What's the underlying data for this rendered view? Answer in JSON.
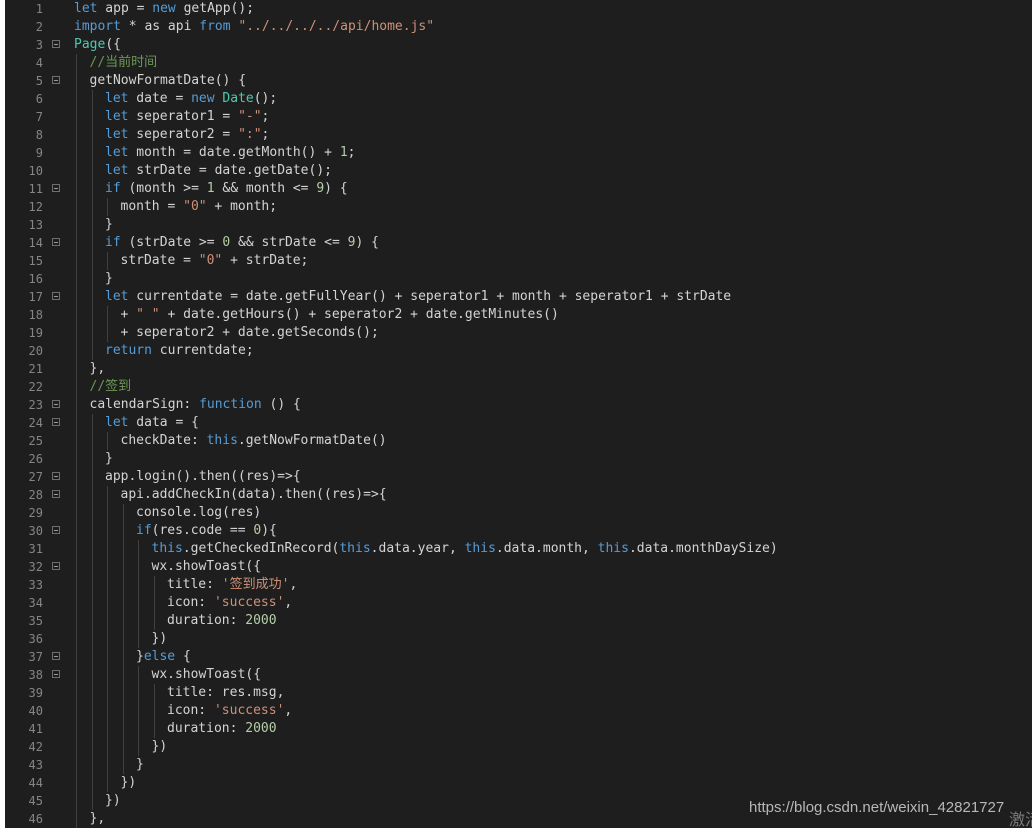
{
  "theme": {
    "default": "#d4d4d4",
    "keyword": "#569cd6",
    "string": "#ce9178",
    "number": "#b5cea8",
    "comment": "#6a9955",
    "class": "#4ec9b0"
  },
  "fold_lines": [
    3,
    5,
    11,
    14,
    17,
    23,
    24,
    27,
    28,
    30,
    32,
    37,
    38
  ],
  "lines": [
    {
      "n": "1",
      "indent": 0,
      "tokens": [
        [
          "kw",
          "let"
        ],
        [
          "p",
          " app = "
        ],
        [
          "kw",
          "new"
        ],
        [
          "p",
          " getApp();"
        ]
      ]
    },
    {
      "n": "2",
      "indent": 0,
      "tokens": [
        [
          "kw",
          "import"
        ],
        [
          "p",
          " * as api "
        ],
        [
          "kw",
          "from"
        ],
        [
          "p",
          " "
        ],
        [
          "str",
          "\"../../../../api/home.js\""
        ]
      ]
    },
    {
      "n": "3",
      "indent": 0,
      "tokens": [
        [
          "cls",
          "Page"
        ],
        [
          "p",
          "({"
        ]
      ]
    },
    {
      "n": "4",
      "indent": 1,
      "tokens": [
        [
          "cm",
          "//当前时间"
        ]
      ]
    },
    {
      "n": "5",
      "indent": 1,
      "tokens": [
        [
          "p",
          "getNowFormatDate() {"
        ]
      ]
    },
    {
      "n": "6",
      "indent": 2,
      "tokens": [
        [
          "kw",
          "let"
        ],
        [
          "p",
          " date = "
        ],
        [
          "kw",
          "new"
        ],
        [
          "p",
          " "
        ],
        [
          "cls",
          "Date"
        ],
        [
          "p",
          "();"
        ]
      ]
    },
    {
      "n": "7",
      "indent": 2,
      "tokens": [
        [
          "kw",
          "let"
        ],
        [
          "p",
          " seperator1 = "
        ],
        [
          "str",
          "\"-\""
        ],
        [
          "p",
          ";"
        ]
      ]
    },
    {
      "n": "8",
      "indent": 2,
      "tokens": [
        [
          "kw",
          "let"
        ],
        [
          "p",
          " seperator2 = "
        ],
        [
          "str",
          "\":\""
        ],
        [
          "p",
          ";"
        ]
      ]
    },
    {
      "n": "9",
      "indent": 2,
      "tokens": [
        [
          "kw",
          "let"
        ],
        [
          "p",
          " month = date.getMonth() + "
        ],
        [
          "num",
          "1"
        ],
        [
          "p",
          ";"
        ]
      ]
    },
    {
      "n": "10",
      "indent": 2,
      "tokens": [
        [
          "kw",
          "let"
        ],
        [
          "p",
          " strDate = date.getDate();"
        ]
      ]
    },
    {
      "n": "11",
      "indent": 2,
      "tokens": [
        [
          "kw",
          "if"
        ],
        [
          "p",
          " (month >= "
        ],
        [
          "num",
          "1"
        ],
        [
          "p",
          " && month <= "
        ],
        [
          "num",
          "9"
        ],
        [
          "p",
          ") {"
        ]
      ]
    },
    {
      "n": "12",
      "indent": 3,
      "tokens": [
        [
          "p",
          "month = "
        ],
        [
          "str",
          "\"0\""
        ],
        [
          "p",
          " + month;"
        ]
      ]
    },
    {
      "n": "13",
      "indent": 2,
      "tokens": [
        [
          "p",
          "}"
        ]
      ]
    },
    {
      "n": "14",
      "indent": 2,
      "tokens": [
        [
          "kw",
          "if"
        ],
        [
          "p",
          " (strDate >= "
        ],
        [
          "num",
          "0"
        ],
        [
          "p",
          " && strDate <= "
        ],
        [
          "num",
          "9"
        ],
        [
          "p",
          ") {"
        ]
      ]
    },
    {
      "n": "15",
      "indent": 3,
      "tokens": [
        [
          "p",
          "strDate = "
        ],
        [
          "str",
          "\"0\""
        ],
        [
          "p",
          " + strDate;"
        ]
      ]
    },
    {
      "n": "16",
      "indent": 2,
      "tokens": [
        [
          "p",
          "}"
        ]
      ]
    },
    {
      "n": "17",
      "indent": 2,
      "tokens": [
        [
          "kw",
          "let"
        ],
        [
          "p",
          " currentdate = date.getFullYear() + seperator1 + month + seperator1 + strDate"
        ]
      ]
    },
    {
      "n": "18",
      "indent": 3,
      "tokens": [
        [
          "p",
          "+ "
        ],
        [
          "str",
          "\" \""
        ],
        [
          "p",
          " + date.getHours() + seperator2 + date.getMinutes()"
        ]
      ]
    },
    {
      "n": "19",
      "indent": 3,
      "tokens": [
        [
          "p",
          "+ seperator2 + date.getSeconds();"
        ]
      ]
    },
    {
      "n": "20",
      "indent": 2,
      "tokens": [
        [
          "kw",
          "return"
        ],
        [
          "p",
          " currentdate;"
        ]
      ]
    },
    {
      "n": "21",
      "indent": 1,
      "tokens": [
        [
          "p",
          "},"
        ]
      ]
    },
    {
      "n": "22",
      "indent": 1,
      "tokens": [
        [
          "cm",
          "//签到"
        ]
      ]
    },
    {
      "n": "23",
      "indent": 1,
      "tokens": [
        [
          "p",
          "calendarSign: "
        ],
        [
          "kw",
          "function"
        ],
        [
          "p",
          " () {"
        ]
      ]
    },
    {
      "n": "24",
      "indent": 2,
      "tokens": [
        [
          "kw",
          "let"
        ],
        [
          "p",
          " data = {"
        ]
      ]
    },
    {
      "n": "25",
      "indent": 3,
      "tokens": [
        [
          "p",
          "checkDate: "
        ],
        [
          "kw",
          "this"
        ],
        [
          "p",
          ".getNowFormatDate()"
        ]
      ]
    },
    {
      "n": "26",
      "indent": 2,
      "tokens": [
        [
          "p",
          "}"
        ]
      ]
    },
    {
      "n": "27",
      "indent": 2,
      "tokens": [
        [
          "p",
          "app.login().then((res)=>{"
        ]
      ]
    },
    {
      "n": "28",
      "indent": 3,
      "tokens": [
        [
          "p",
          "api.addCheckIn(data).then((res)=>{"
        ]
      ]
    },
    {
      "n": "29",
      "indent": 4,
      "tokens": [
        [
          "p",
          "console.log(res)"
        ]
      ]
    },
    {
      "n": "30",
      "indent": 4,
      "tokens": [
        [
          "kw",
          "if"
        ],
        [
          "p",
          "(res.code == "
        ],
        [
          "num",
          "0"
        ],
        [
          "p",
          "){"
        ]
      ]
    },
    {
      "n": "31",
      "indent": 5,
      "tokens": [
        [
          "kw",
          "this"
        ],
        [
          "p",
          ".getCheckedInRecord("
        ],
        [
          "kw",
          "this"
        ],
        [
          "p",
          ".data.year, "
        ],
        [
          "kw",
          "this"
        ],
        [
          "p",
          ".data.month, "
        ],
        [
          "kw",
          "this"
        ],
        [
          "p",
          ".data.monthDaySize)"
        ]
      ]
    },
    {
      "n": "32",
      "indent": 5,
      "tokens": [
        [
          "p",
          "wx.showToast({"
        ]
      ]
    },
    {
      "n": "33",
      "indent": 6,
      "tokens": [
        [
          "p",
          "title: "
        ],
        [
          "str",
          "'签到成功'"
        ],
        [
          "p",
          ","
        ]
      ]
    },
    {
      "n": "34",
      "indent": 6,
      "tokens": [
        [
          "p",
          "icon: "
        ],
        [
          "str",
          "'success'"
        ],
        [
          "p",
          ","
        ]
      ]
    },
    {
      "n": "35",
      "indent": 6,
      "tokens": [
        [
          "p",
          "duration: "
        ],
        [
          "num",
          "2000"
        ]
      ]
    },
    {
      "n": "36",
      "indent": 5,
      "tokens": [
        [
          "p",
          "})"
        ]
      ]
    },
    {
      "n": "37",
      "indent": 4,
      "tokens": [
        [
          "p",
          "}"
        ],
        [
          "kw",
          "else"
        ],
        [
          "p",
          " {"
        ]
      ]
    },
    {
      "n": "38",
      "indent": 5,
      "tokens": [
        [
          "p",
          "wx.showToast({"
        ]
      ]
    },
    {
      "n": "39",
      "indent": 6,
      "tokens": [
        [
          "p",
          "title: res.msg,"
        ]
      ]
    },
    {
      "n": "40",
      "indent": 6,
      "tokens": [
        [
          "p",
          "icon: "
        ],
        [
          "str",
          "'success'"
        ],
        [
          "p",
          ","
        ]
      ]
    },
    {
      "n": "41",
      "indent": 6,
      "tokens": [
        [
          "p",
          "duration: "
        ],
        [
          "num",
          "2000"
        ]
      ]
    },
    {
      "n": "42",
      "indent": 5,
      "tokens": [
        [
          "p",
          "})"
        ]
      ]
    },
    {
      "n": "43",
      "indent": 4,
      "tokens": [
        [
          "p",
          "}"
        ]
      ]
    },
    {
      "n": "44",
      "indent": 3,
      "tokens": [
        [
          "p",
          "})"
        ]
      ]
    },
    {
      "n": "45",
      "indent": 2,
      "tokens": [
        [
          "p",
          "})"
        ]
      ]
    },
    {
      "n": "46",
      "indent": 1,
      "tokens": [
        [
          "p",
          "},"
        ]
      ]
    }
  ],
  "watermark": {
    "text": "https://blog.csdn.net/weixin_42821727",
    "tail": "激活"
  }
}
